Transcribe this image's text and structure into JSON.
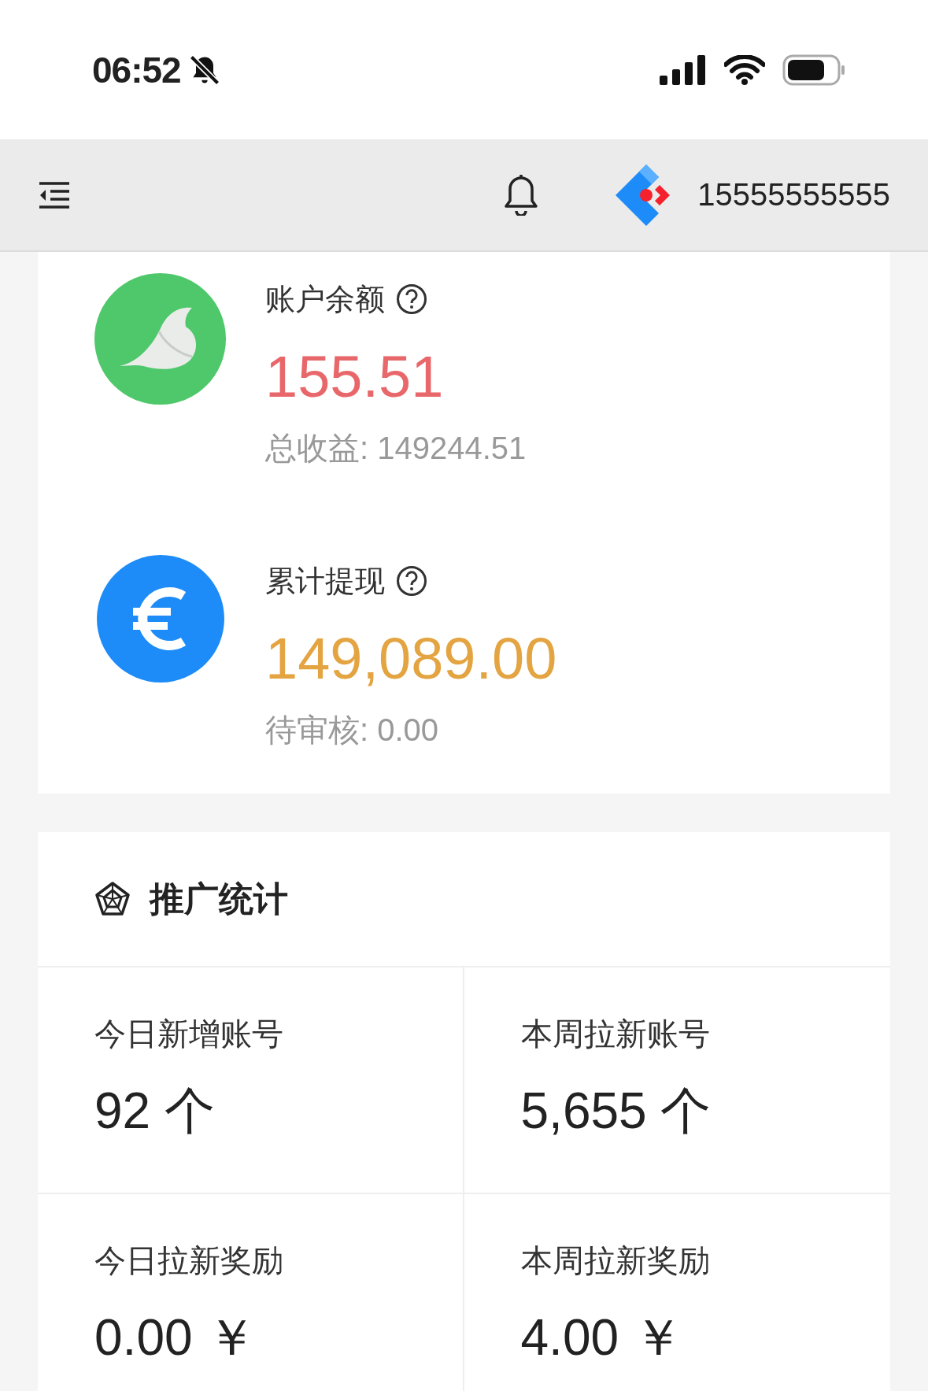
{
  "status_bar": {
    "time": "06:52"
  },
  "header": {
    "account": "15555555555"
  },
  "balances": [
    {
      "kind": "bird",
      "label": "账户余额",
      "value": "155.51",
      "color": "#e8676a",
      "sub": "总收益: 149244.51"
    },
    {
      "kind": "euro",
      "label": "累计提现",
      "value": "149,089.00",
      "color": "#e3a441",
      "sub": "待审核: 0.00"
    }
  ],
  "stats": {
    "title": "推广统计",
    "items": [
      {
        "label": "今日新增账号",
        "value": "92 个"
      },
      {
        "label": "本周拉新账号",
        "value": "5,655 个"
      },
      {
        "label": "今日拉新奖励",
        "value": "0.00 ￥"
      },
      {
        "label": "本周拉新奖励",
        "value": "4.00 ￥"
      }
    ]
  }
}
